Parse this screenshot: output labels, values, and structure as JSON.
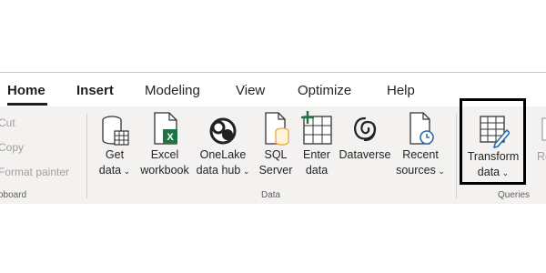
{
  "tabs": [
    {
      "label": "Home",
      "active": true
    },
    {
      "label": "Insert",
      "active": false
    },
    {
      "label": "Modeling",
      "active": false
    },
    {
      "label": "View",
      "active": false
    },
    {
      "label": "Optimize",
      "active": false
    },
    {
      "label": "Help",
      "active": false
    }
  ],
  "clipboard": {
    "cut_label": "Cut",
    "copy_label": "Copy",
    "format_painter_label": "Format painter",
    "group_label": "oboard"
  },
  "data_group": {
    "group_label": "Data",
    "buttons": [
      {
        "line1": "Get",
        "line2": "data",
        "chevron": true,
        "icon": "database-icon"
      },
      {
        "line1": "Excel",
        "line2": "workbook",
        "chevron": false,
        "icon": "excel-icon"
      },
      {
        "line1": "OneLake",
        "line2": "data hub",
        "chevron": true,
        "icon": "onelake-icon"
      },
      {
        "line1": "SQL",
        "line2": "Server",
        "chevron": false,
        "icon": "sql-server-icon"
      },
      {
        "line1": "Enter",
        "line2": "data",
        "chevron": false,
        "icon": "table-add-icon"
      },
      {
        "line1": "Dataverse",
        "line2": "",
        "chevron": false,
        "icon": "dataverse-icon"
      },
      {
        "line1": "Recent",
        "line2": "sources",
        "chevron": true,
        "icon": "recent-sources-icon"
      }
    ]
  },
  "queries_group": {
    "group_label": "Queries",
    "transform": {
      "line1": "Transform",
      "line2": "data",
      "chevron": true,
      "icon": "transform-data-icon"
    },
    "refresh_partial": "Refr"
  },
  "colors": {
    "accent": "#217346",
    "icon_blue": "#2b6cb0",
    "icon_orange": "#e8a93a",
    "highlight": "#000000"
  }
}
